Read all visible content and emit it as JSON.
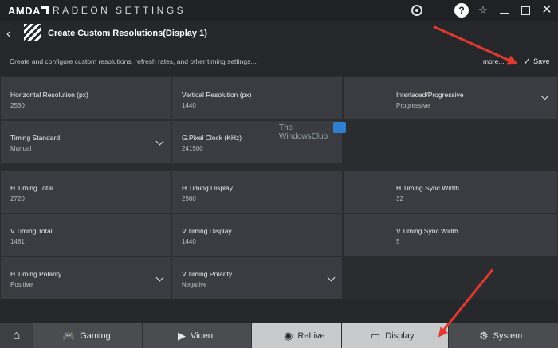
{
  "app": {
    "brand": "AMDA",
    "title": "RADEON SETTINGS"
  },
  "header": {
    "back_icon": "chevron-left-icon",
    "title": "Create Custom Resolutions(Display 1)",
    "description": "Create and configure custom resolutions, refresh rates, and other timing settings....",
    "more_label": "more...",
    "save_label": "Save"
  },
  "fields": {
    "h_resolution": {
      "label": "Horizontal Resolution (px)",
      "value": "2560"
    },
    "v_resolution": {
      "label": "Vertical Resolution (px)",
      "value": "1440"
    },
    "interlaced": {
      "label": "Interlaced/Progressive",
      "value": "Progressive"
    },
    "timing_standard": {
      "label": "Timing Standard",
      "value": "Manual"
    },
    "pixel_clock": {
      "label": "G.Pixel Clock (KHz)",
      "value": "241500"
    },
    "h_timing_total": {
      "label": "H.Timing Total",
      "value": "2720"
    },
    "h_timing_display": {
      "label": "H.Timing Display",
      "value": "2560"
    },
    "h_timing_sync_width": {
      "label": "H.Timing Sync Width",
      "value": "32"
    },
    "v_timing_total": {
      "label": "V.Timing Total",
      "value": "1481"
    },
    "v_timing_display": {
      "label": "V.Timing Display",
      "value": "1440"
    },
    "v_timing_sync_width": {
      "label": "V.Timing Sync Width",
      "value": "5"
    },
    "h_timing_polarity": {
      "label": "H.Timing Polarity",
      "value": "Positive"
    },
    "v_timing_polarity": {
      "label": "V.Timing Polarity",
      "value": "Negative"
    }
  },
  "watermark": {
    "line1": "The",
    "line2": "WindowsClub"
  },
  "nav": {
    "home_icon": "home-icon",
    "gaming": "Gaming",
    "video": "Video",
    "relive": "ReLive",
    "display": "Display",
    "system": "System"
  },
  "colors": {
    "accent_arrow": "#e03a2f",
    "selected_tab": "#c9cacc"
  }
}
